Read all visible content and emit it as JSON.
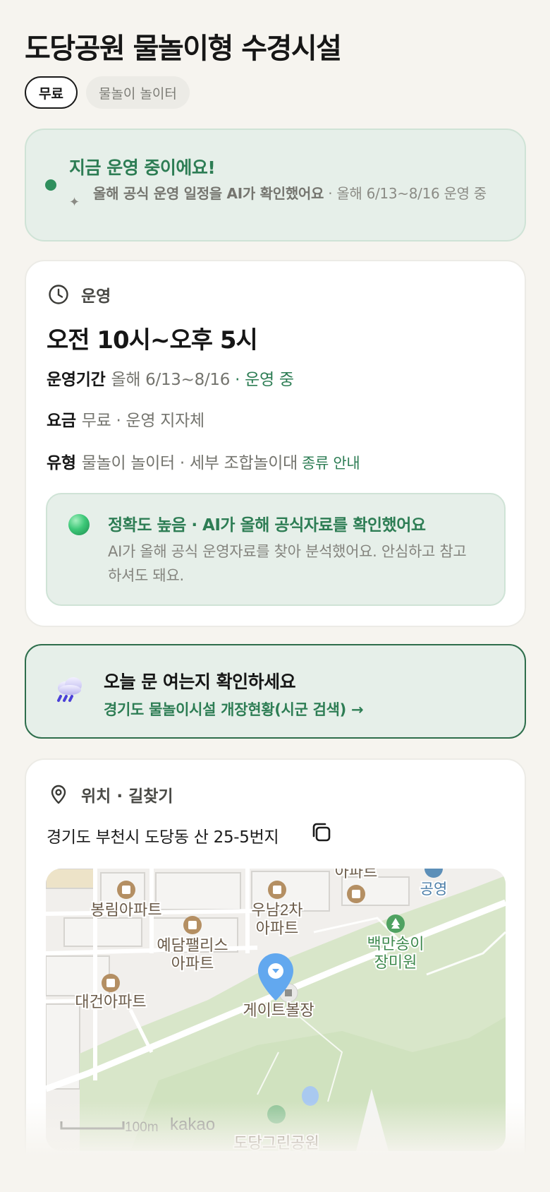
{
  "header": {
    "title": "도당공원 물놀이형 수경시설"
  },
  "chips": [
    {
      "label": "무료",
      "active": true
    },
    {
      "label": "물놀이 놀이터",
      "active": false
    }
  ],
  "status": {
    "title": "지금 운영 중이에요!",
    "desc_strong": "올해 공식 운영 일정을 AI가 확인했어요",
    "desc_rest": " · 올해 6/13~8/16 운영 중",
    "sparkle": "✦"
  },
  "operation": {
    "heading": "운영",
    "hours": "오전 10시~오후 5시",
    "period_label": "운영기간",
    "period_value": "올해 6/13~8/16",
    "period_status": "· 운영 중",
    "fee_label": "요금",
    "fee_value": "무료 · 운영 지자체",
    "type_label": "유형",
    "type_value": "물놀이 놀이터",
    "type_detail": "· 세부 조합놀이대",
    "type_link": "종류 안내",
    "accuracy_title": "정확도 높음 · AI가 올해 공식자료를 확인했어요",
    "accuracy_desc": "AI가 올해 공식 운영자료를 찾아 분석했어요. 안심하고 참고하셔도 돼요."
  },
  "notice": {
    "title": "오늘 문 여는지 확인하세요",
    "link": "경기도 물놀이시설 개장현황(시군 검색) →"
  },
  "location": {
    "heading": "위치 · 길찾기",
    "address": "경기도 부천시 도당동 산 25-5번지",
    "map": {
      "labels": {
        "bongrim": "봉림아파트",
        "umnam1": "우남2차",
        "umnam2": "아파트",
        "apt_top": "아파트",
        "gongyeong": "공영",
        "yedam1": "예담팰리스",
        "yedam2": "아파트",
        "baekman1": "백만송이",
        "baekman2": "장미원",
        "daegun": "대건아파트",
        "gatebol": "게이트볼장",
        "dodang": "도당그린공원",
        "scale": "100m",
        "logo": "kakao"
      }
    }
  }
}
